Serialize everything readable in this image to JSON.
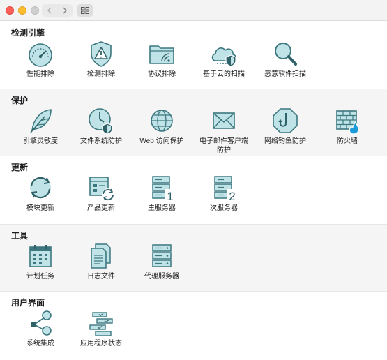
{
  "colors": {
    "icon_fill": "#bfe3e6",
    "icon_stroke": "#3d7880",
    "accent_dark": "#2f6168",
    "flame": "#1d9bd7"
  },
  "titlebar": {
    "traffic_lights": [
      "close",
      "minimize",
      "zoom"
    ],
    "back_icon": "chevron-left-icon",
    "forward_icon": "chevron-right-icon",
    "grid_icon": "grid-icon"
  },
  "sections": [
    {
      "title": "检测引擎",
      "items": [
        {
          "label": "性能排除",
          "icon": "gauge-icon"
        },
        {
          "label": "检测排除",
          "icon": "shield-warning-icon"
        },
        {
          "label": "协议排除",
          "icon": "folder-signal-icon"
        },
        {
          "label": "基于云的扫描",
          "icon": "cloud-shield-icon"
        },
        {
          "label": "恶意软件扫描",
          "icon": "magnifier-icon"
        }
      ]
    },
    {
      "title": "保护",
      "items": [
        {
          "label": "引擎灵敏度",
          "icon": "feather-icon"
        },
        {
          "label": "文件系统防护",
          "icon": "clock-shield-icon"
        },
        {
          "label": "Web 访问保护",
          "icon": "globe-icon"
        },
        {
          "label_line1": "电子邮件客户端",
          "label_line2": "防护",
          "icon": "envelope-icon"
        },
        {
          "label": "网络钓鱼防护",
          "icon": "hook-octagon-icon"
        },
        {
          "label": "防火墙",
          "icon": "firewall-icon"
        }
      ]
    },
    {
      "title": "更新",
      "items": [
        {
          "label": "模块更新",
          "icon": "refresh-icon"
        },
        {
          "label": "产品更新",
          "icon": "window-refresh-icon"
        },
        {
          "label": "主服务器",
          "icon": "server-primary-icon",
          "badge": "1"
        },
        {
          "label": "次服务器",
          "icon": "server-secondary-icon",
          "badge": "2"
        }
      ]
    },
    {
      "title": "工具",
      "items": [
        {
          "label": "计划任务",
          "icon": "calendar-icon"
        },
        {
          "label": "日志文件",
          "icon": "documents-icon"
        },
        {
          "label": "代理服务器",
          "icon": "server-stack-icon"
        }
      ]
    },
    {
      "title": "用户界面",
      "items": [
        {
          "label": "系统集成",
          "icon": "share-nodes-icon"
        },
        {
          "label": "应用程序状态",
          "icon": "status-bars-icon"
        }
      ]
    }
  ]
}
